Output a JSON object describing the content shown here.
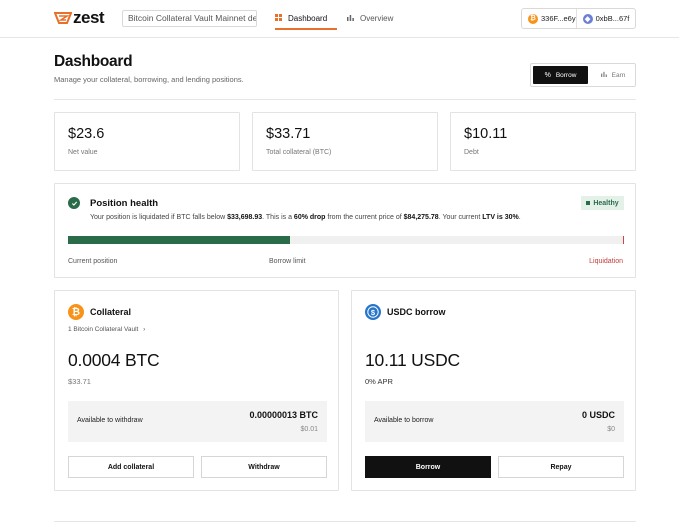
{
  "brand": {
    "name": "zest",
    "accent": "#e8702a"
  },
  "header": {
    "network_label": "Bitcoin Collateral Vault Mainnet demo",
    "tabs": [
      {
        "label": "Dashboard",
        "icon": "grid-icon",
        "active": true
      },
      {
        "label": "Overview",
        "icon": "bar-chart-icon",
        "active": false
      }
    ],
    "wallets": [
      {
        "label": "336F...e6y",
        "icon": "bitcoin-icon"
      },
      {
        "label": "0xbB...67f",
        "icon": "ethereum-icon"
      }
    ]
  },
  "page": {
    "title": "Dashboard",
    "subtitle": "Manage your collateral, borrowing, and lending positions.",
    "modes": [
      {
        "label": "Borrow",
        "active": true
      },
      {
        "label": "Earn",
        "active": false
      }
    ]
  },
  "stats": [
    {
      "value": "$23.6",
      "label": "Net value"
    },
    {
      "value": "$33.71",
      "label": "Total collateral (BTC)"
    },
    {
      "value": "$10.11",
      "label": "Debt"
    }
  ],
  "health": {
    "title": "Position health",
    "badge": "Healthy",
    "msg_prefix": "Your position is liquidated if BTC falls below ",
    "liq_price": "$33,698.93",
    "msg_mid1": ". This is a ",
    "drop": "60% drop",
    "msg_mid2": " from the current price of ",
    "current_price": "$84,275.78",
    "msg_mid3": ". Your current ",
    "ltv": "LTV is 30%",
    "msg_end": ".",
    "progress_fraction": 0.4,
    "labels": {
      "current": "Current position",
      "limit": "Borrow limit",
      "liquidation": "Liquidation"
    },
    "colors": {
      "good": "#2a6b4a",
      "danger": "#d94040"
    }
  },
  "collateral": {
    "title": "Collateral",
    "vault_link": "1 Bitcoin Collateral Vault",
    "amount": "0.0004 BTC",
    "usd": "$33.71",
    "available_label": "Available to withdraw",
    "available_value": "0.00000013 BTC",
    "available_usd": "$0.01",
    "add_label": "Add collateral",
    "withdraw_label": "Withdraw"
  },
  "borrow": {
    "title": "USDC borrow",
    "amount": "10.11 USDC",
    "apr": "0% APR",
    "available_label": "Available to borrow",
    "available_value": "0 USDC",
    "available_usd": "$0",
    "borrow_label": "Borrow",
    "repay_label": "Repay"
  }
}
